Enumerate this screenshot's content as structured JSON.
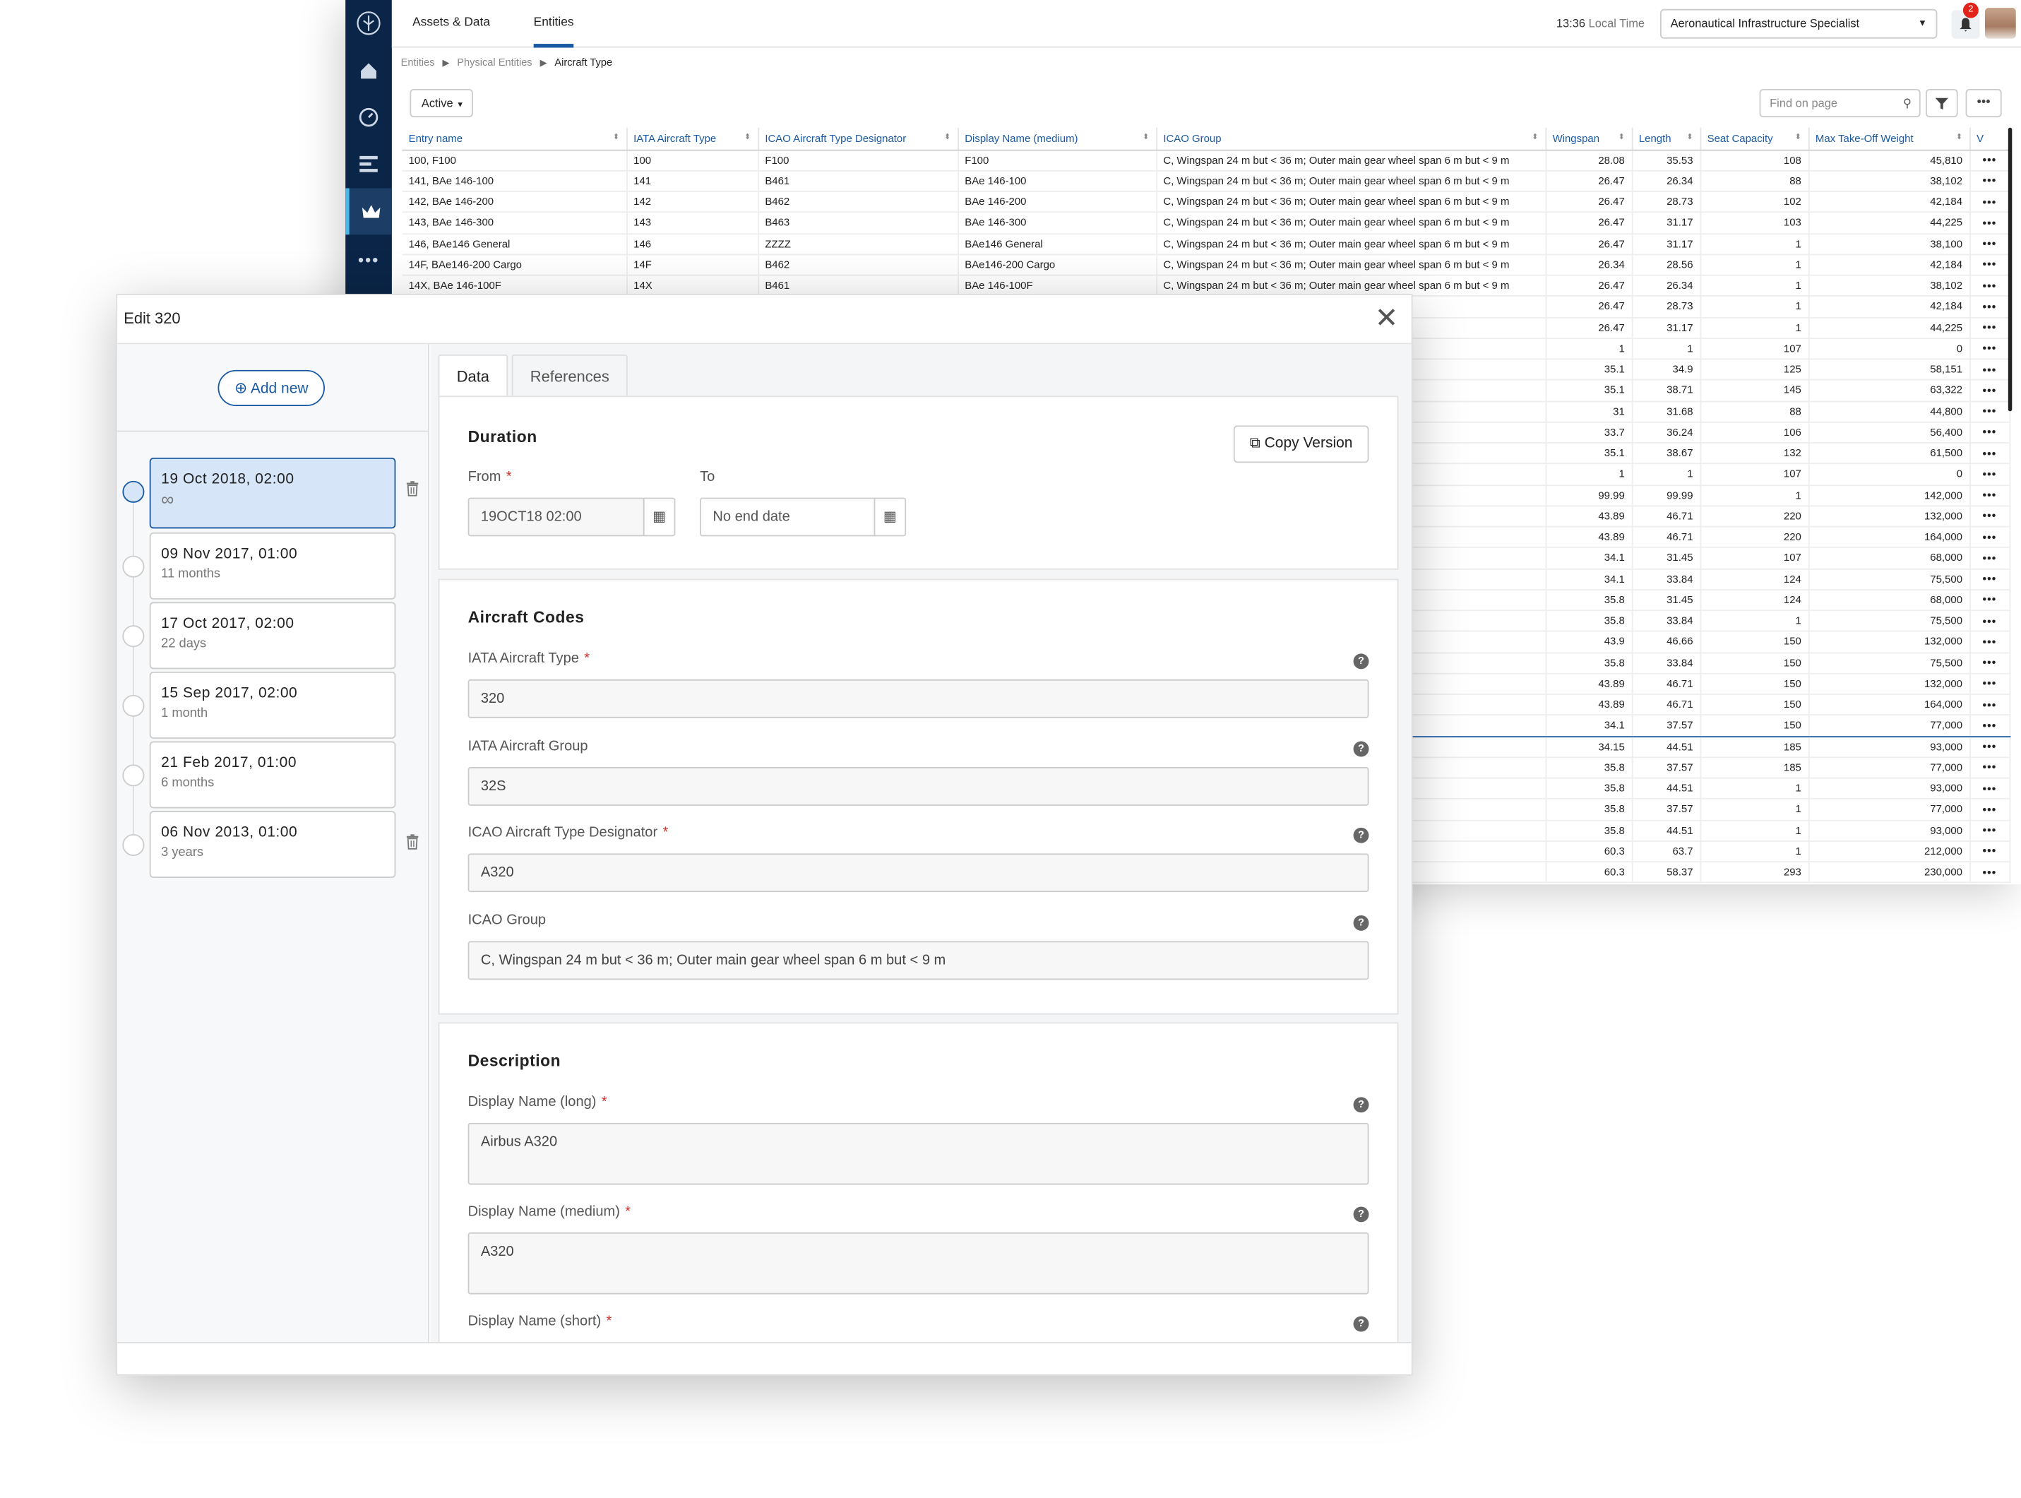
{
  "rail": {
    "icons": [
      "logo-icon",
      "home-icon",
      "gauge-icon",
      "list-icon",
      "crown-icon",
      "more-icon"
    ]
  },
  "topbar": {
    "tabs": [
      "Assets & Data",
      "Entities"
    ],
    "time": "13:36",
    "time_label": "Local Time",
    "role": "Aeronautical Infrastructure Specialist",
    "notifications": "2"
  },
  "breadcrumb": {
    "items": [
      "Entities",
      "Physical Entities",
      "Aircraft Type"
    ]
  },
  "toolbar": {
    "status": "Active",
    "find_placeholder": "Find on page"
  },
  "table": {
    "headers": [
      "Entry name",
      "IATA Aircraft Type",
      "ICAO Aircraft Type Designator",
      "Display Name (medium)",
      "ICAO Group",
      "Wingspan",
      "Length",
      "Seat Capacity",
      "Max Take-Off Weight",
      "V"
    ],
    "rows": [
      [
        "100, F100",
        "100",
        "F100",
        "F100",
        "C, Wingspan 24 m but < 36 m; Outer main gear wheel span 6 m but < 9 m",
        "28.08",
        "35.53",
        "108",
        "45,810"
      ],
      [
        "141, BAe 146-100",
        "141",
        "B461",
        "BAe 146-100",
        "C, Wingspan 24 m but < 36 m; Outer main gear wheel span 6 m but < 9 m",
        "26.47",
        "26.34",
        "88",
        "38,102"
      ],
      [
        "142, BAe 146-200",
        "142",
        "B462",
        "BAe 146-200",
        "C, Wingspan 24 m but < 36 m; Outer main gear wheel span 6 m but < 9 m",
        "26.47",
        "28.73",
        "102",
        "42,184"
      ],
      [
        "143, BAe 146-300",
        "143",
        "B463",
        "BAe 146-300",
        "C, Wingspan 24 m but < 36 m; Outer main gear wheel span 6 m but < 9 m",
        "26.47",
        "31.17",
        "103",
        "44,225"
      ],
      [
        "146, BAe146 General",
        "146",
        "ZZZZ",
        "BAe146 General",
        "C, Wingspan 24 m but < 36 m; Outer main gear wheel span 6 m but < 9 m",
        "26.47",
        "31.17",
        "1",
        "38,100"
      ],
      [
        "14F, BAe146-200 Cargo",
        "14F",
        "B462",
        "BAe146-200 Cargo",
        "C, Wingspan 24 m but < 36 m; Outer main gear wheel span 6 m but < 9 m",
        "26.34",
        "28.56",
        "1",
        "42,184"
      ],
      [
        "14X, BAe 146-100F",
        "14X",
        "B461",
        "BAe 146-100F",
        "C, Wingspan 24 m but < 36 m; Outer main gear wheel span 6 m but < 9 m",
        "26.47",
        "26.34",
        "1",
        "38,102"
      ],
      [
        "",
        "",
        "",
        "",
        "eel span 6 m but < 9 m",
        "26.47",
        "28.73",
        "1",
        "42,184"
      ],
      [
        "",
        "",
        "",
        "",
        "< 4.5 m",
        "26.47",
        "31.17",
        "1",
        "44,225"
      ],
      [
        "",
        "",
        "",
        "",
        ": 4.5 m",
        "1",
        "1",
        "107",
        "0"
      ],
      [
        "",
        "",
        "",
        "",
        "eel span 6 m but < 9 m",
        "35.1",
        "34.9",
        "125",
        "58,151"
      ],
      [
        "",
        "",
        "",
        "",
        "eel span 6 m but < 9 m",
        "35.1",
        "38.71",
        "145",
        "63,322"
      ],
      [
        "",
        "",
        "",
        "",
        "eel span 6 m but < 9 m",
        "31",
        "31.68",
        "88",
        "44,800"
      ],
      [
        "",
        "",
        "",
        "",
        "eel span 6 m but < 9 m",
        "33.7",
        "36.24",
        "106",
        "56,400"
      ],
      [
        "",
        "",
        "",
        "",
        "eel span 6 m but < 9 m",
        "35.1",
        "38.67",
        "132",
        "61,500"
      ],
      [
        "",
        "",
        "",
        "",
        "eel span 6 m but < 9 m",
        "1",
        "1",
        "107",
        "0"
      ],
      [
        "",
        "",
        "",
        "",
        "eel span 9 m but < 14 m",
        "99.99",
        "99.99",
        "1",
        "142,000"
      ],
      [
        "",
        "",
        "",
        "",
        "eel span 9 m but < 14 m",
        "43.89",
        "46.71",
        "220",
        "132,000"
      ],
      [
        "",
        "",
        "",
        "",
        "eel span 9 m but < 14 m",
        "43.89",
        "46.71",
        "220",
        "164,000"
      ],
      [
        "",
        "",
        "",
        "",
        "eel span 6 m but < 9 m",
        "34.1",
        "31.45",
        "107",
        "68,000"
      ],
      [
        "",
        "",
        "",
        "",
        "eel span 6 m but < 9 m",
        "34.1",
        "33.84",
        "124",
        "75,500"
      ],
      [
        "",
        "",
        "",
        "",
        "eel span 6 m but < 9 m",
        "35.8",
        "31.45",
        "124",
        "68,000"
      ],
      [
        "",
        "",
        "",
        "",
        "eel span 9 m but < 14 m",
        "35.8",
        "33.84",
        "1",
        "75,500"
      ],
      [
        "",
        "",
        "",
        "",
        "eel span 6 m but < 9 m",
        "43.9",
        "46.66",
        "150",
        "132,000"
      ],
      [
        "",
        "",
        "",
        "",
        "eel span 9 m but < 14 m",
        "35.8",
        "33.84",
        "150",
        "75,500"
      ],
      [
        "",
        "",
        "",
        "",
        "eel span 9 m but < 14 m",
        "43.89",
        "46.71",
        "150",
        "132,000"
      ],
      [
        "",
        "",
        "",
        "",
        "eel span 6 m but < 9 m",
        "43.89",
        "46.71",
        "150",
        "164,000"
      ],
      [
        "",
        "",
        "",
        "",
        "eel span 6 m but < 9 m",
        "34.1",
        "37.57",
        "150",
        "77,000"
      ],
      [
        "",
        "",
        "",
        "",
        "eel span 6 m but < 9 m",
        "34.15",
        "44.51",
        "185",
        "93,000"
      ],
      [
        "",
        "",
        "",
        "",
        "eel span 6 m but < 9 m",
        "35.8",
        "37.57",
        "185",
        "77,000"
      ],
      [
        "",
        "",
        "",
        "",
        "eel span 6 m but < 9 m",
        "35.8",
        "44.51",
        "1",
        "93,000"
      ],
      [
        "",
        "",
        "",
        "",
        "eel span 6 m but < 9 m",
        "35.8",
        "37.57",
        "1",
        "77,000"
      ],
      [
        "",
        "",
        "",
        "",
        "eel span 9 m but < 14 m",
        "35.8",
        "44.51",
        "1",
        "93,000"
      ],
      [
        "",
        "",
        "",
        "",
        "eel span 9 m but < 14 m",
        "60.3",
        "63.7",
        "1",
        "212,000"
      ],
      [
        "",
        "",
        "",
        "",
        "eel span 9 m but < 14 m",
        "60.3",
        "58.37",
        "293",
        "230,000"
      ]
    ]
  },
  "modal": {
    "title": "Edit 320",
    "add_new": "Add new",
    "versions": [
      {
        "date": "19 Oct 2018, 02:00",
        "age": "∞"
      },
      {
        "date": "09 Nov 2017, 01:00",
        "age": "11 months"
      },
      {
        "date": "17 Oct 2017, 02:00",
        "age": "22 days"
      },
      {
        "date": "15 Sep 2017, 02:00",
        "age": "1 month"
      },
      {
        "date": "21 Feb 2017, 01:00",
        "age": "6 months"
      },
      {
        "date": "06 Nov 2013, 01:00",
        "age": "3 years"
      }
    ],
    "tabs": [
      "Data",
      "References"
    ],
    "duration": {
      "title": "Duration",
      "from_label": "From",
      "to_label": "To",
      "from_value": "19OCT18 02:00",
      "to_placeholder": "No end date",
      "copy_version": "Copy Version"
    },
    "codes": {
      "title": "Aircraft Codes",
      "iata_type_label": "IATA Aircraft Type",
      "iata_type_value": "320",
      "iata_group_label": "IATA Aircraft Group",
      "iata_group_value": "32S",
      "icao_type_label": "ICAO Aircraft Type Designator",
      "icao_type_value": "A320",
      "icao_group_label": "ICAO Group",
      "icao_group_value": "C, Wingspan 24 m but < 36 m; Outer main gear wheel span 6 m but < 9 m"
    },
    "description": {
      "title": "Description",
      "long_label": "Display Name (long)",
      "long_value": "Airbus A320",
      "medium_label": "Display Name (medium)",
      "medium_value": "A320",
      "short_label": "Display Name (short)"
    }
  },
  "colors": {
    "rail": "#0a2547",
    "accent": "#1a5aa3",
    "selected_version": "#d6e6f8",
    "required": "#d3312a"
  }
}
